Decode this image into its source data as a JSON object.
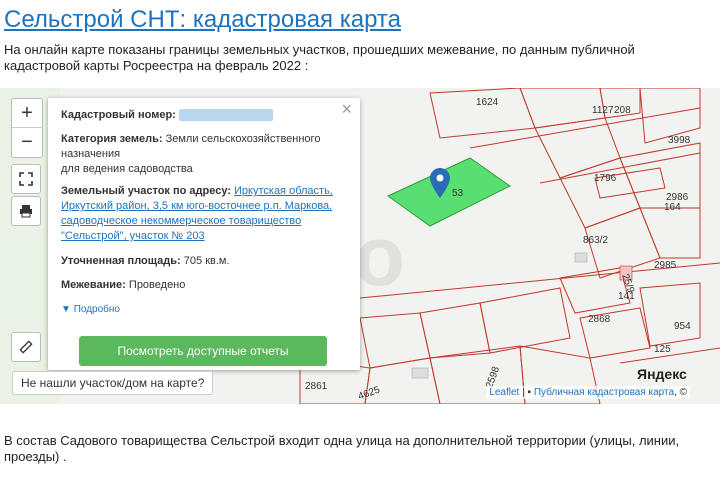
{
  "title": "Сельстрой СНТ: кадастровая карта",
  "intro": "На онлайн карте показаны границы земельных участков, прошедших межевание, по данным публичной кадастровой карты Росреестра на февраль 2022 :",
  "map": {
    "zoom_in": "+",
    "zoom_out": "−",
    "plot_labels": [
      "1624",
      "1127",
      "208",
      "3998",
      "1796",
      "2986",
      "164",
      "863/2",
      "2985",
      "141",
      "2868",
      "954",
      "125",
      "2861",
      "2598",
      "4625",
      "25/9"
    ],
    "selected_plot_label": "53",
    "not_found_label": "Не нашли участок/дом на карте?",
    "watermark": "Avito",
    "yandex_logo": "Яндекс",
    "attribution": {
      "leaflet": "Leaflet",
      "separator": " | ",
      "kadastr": "Публичная кадастровая карта",
      "suffix": ", ©"
    },
    "popup": {
      "cadastral_label": "Кадастровый номер:",
      "category_label": "Категория земель:",
      "category_value": "Земли сельскохозяйственного назначения",
      "category_sub": "для ведения садоводства",
      "address_label": "Земельный участок по адресу:",
      "address_value": "Иркутская область, Иркутский район, 3,5 км юго-восточнее р.п. Маркова, садоводческое некоммерческое товарищество \"Сельстрой\", участок № 203",
      "area_label": "Уточненная площадь:",
      "area_value": "705 кв.м.",
      "survey_label": "Межевание:",
      "survey_value": "Проведено",
      "more_label": "Подробно",
      "reports_button": "Посмотреть доступные отчеты",
      "close": "×"
    }
  },
  "outro": "В состав Садового товарищества Сельстрой входит одна улица на дополнительной территории (улицы, линии, проезды) ."
}
